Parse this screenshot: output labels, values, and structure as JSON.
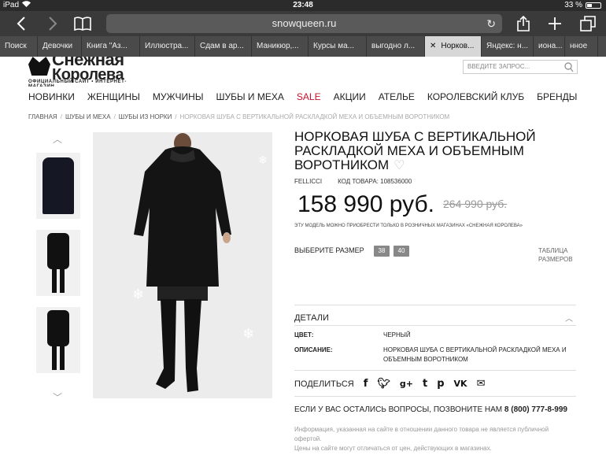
{
  "status_bar": {
    "device": "iPad",
    "time": "23:48",
    "battery": "33 %",
    "battery_level": 0.33
  },
  "browser": {
    "url": "snowqueen.ru",
    "tabs": [
      {
        "label": "Поиск",
        "active": false
      },
      {
        "label": "Девочки",
        "active": false
      },
      {
        "label": "Книга \"Аз...",
        "active": false
      },
      {
        "label": "Иллюстра...",
        "active": false
      },
      {
        "label": "Сдам в ар...",
        "active": false
      },
      {
        "label": "Маникюр,...",
        "active": false
      },
      {
        "label": "Курсы ма...",
        "active": false
      },
      {
        "label": "выгодно л...",
        "active": false
      },
      {
        "label": "Норков...",
        "active": true
      },
      {
        "label": "Яндекс: н...",
        "active": false
      },
      {
        "label": "иона...",
        "active": false
      },
      {
        "label": "нное",
        "active": false
      }
    ]
  },
  "header": {
    "logo_text_1": "Снежная",
    "logo_text_2": "Королева",
    "logo_tagline": "ОФИЦИАЛЬНЫЙ САЙТ • ИНТЕРНЕТ-МАГАЗИН",
    "search_placeholder": "ВВЕДИТЕ ЗАПРОС..."
  },
  "nav": [
    "НОВИНКИ",
    "ЖЕНЩИНЫ",
    "МУЖЧИНЫ",
    "ШУБЫ И МЕХА",
    "SALE",
    "АКЦИИ",
    "АТЕЛЬЕ",
    "КОРОЛЕВСКИЙ КЛУБ",
    "БРЕНДЫ"
  ],
  "breadcrumbs": [
    "ГЛАВНАЯ",
    "ШУБЫ И МЕХА",
    "ШУБЫ ИЗ НОРКИ",
    "НОРКОВАЯ ШУБА С ВЕРТИКАЛЬНОЙ РАСКЛАДКОЙ МЕХА И ОБЪЕМНЫМ ВОРОТНИКОМ"
  ],
  "product": {
    "title": "НОРКОВАЯ ШУБА С ВЕРТИКАЛЬНОЙ РАСКЛАДКОЙ МЕХА И ОБЪЕМНЫМ ВОРОТНИКОМ",
    "brand": "FELLICCI",
    "code_label": "КОД ТОВАРА: 108536000",
    "price": "158 990 руб.",
    "old_price": "264 990 руб.",
    "availability_note": "ЭТУ МОДЕЛЬ МОЖНО ПРИОБРЕСТИ ТОЛЬКО В РОЗНИЧНЫХ МАГАЗИНАХ «СНЕЖНАЯ КОРОЛЕВА»",
    "size_label": "ВЫБЕРИТЕ РАЗМЕР",
    "sizes": [
      "38",
      "40"
    ],
    "size_table_1": "ТАБЛИЦА",
    "size_table_2": "РАЗМЕРОВ",
    "details_title": "ДЕТАЛИ",
    "color_label": "ЦВЕТ:",
    "color_value": "ЧЕРНЫЙ",
    "desc_label": "ОПИСАНИЕ:",
    "desc_value": "НОРКОВАЯ ШУБА С ВЕРТИКАЛЬНОЙ РАСКЛАДКОЙ МЕХА И ОБЪЕМНЫМ ВОРОТНИКОМ",
    "share_label": "ПОДЕЛИТЬСЯ",
    "questions_text": "ЕСЛИ У ВАС ОСТАЛИСЬ ВОПРОСЫ, ПОЗВОНИТЕ НАМ",
    "phone": "8 (800) 777-8-999",
    "disclaimer_1": "Информация, указанная на сайте в отношении данного товара не является публичной офертой.",
    "disclaimer_2": "Цены на сайте могут отличаться от цен, действующих в магазинах."
  },
  "colors": {
    "sale": "#c8102e",
    "toolbar": "#3a3a3a"
  }
}
